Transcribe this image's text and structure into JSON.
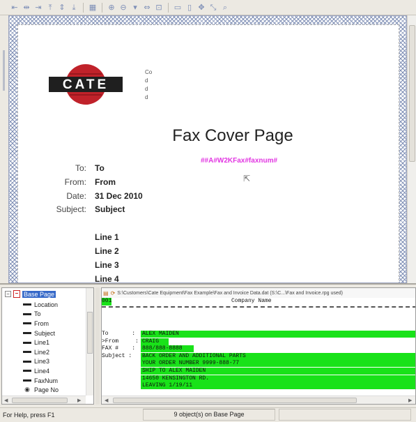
{
  "toolbar": {
    "buttons": [
      {
        "icon": "align-left-icon",
        "glyph": "⇤"
      },
      {
        "icon": "align-center-icon",
        "glyph": "⇹"
      },
      {
        "icon": "align-right-icon",
        "glyph": "⇥"
      },
      {
        "icon": "align-top-icon",
        "glyph": "⤒"
      },
      {
        "icon": "align-middle-icon",
        "glyph": "⇕"
      },
      {
        "icon": "align-bottom-icon",
        "glyph": "⤓"
      },
      {
        "icon": "sep"
      },
      {
        "icon": "grid-icon",
        "glyph": "▦"
      },
      {
        "icon": "sep"
      },
      {
        "icon": "zoom-in-icon",
        "glyph": "⊕"
      },
      {
        "icon": "zoom-out-icon",
        "glyph": "⊖"
      },
      {
        "icon": "zoom-dropdown-icon",
        "glyph": "▾"
      },
      {
        "icon": "fit-width-icon",
        "glyph": "⇔"
      },
      {
        "icon": "fit-page-icon",
        "glyph": "⊡"
      },
      {
        "icon": "sep"
      },
      {
        "icon": "same-width-icon",
        "glyph": "▭"
      },
      {
        "icon": "same-height-icon",
        "glyph": "▯"
      },
      {
        "icon": "move-icon",
        "glyph": "✥"
      },
      {
        "icon": "resize-icon",
        "glyph": "⤡"
      },
      {
        "icon": "find-icon",
        "glyph": "⌕"
      }
    ]
  },
  "design": {
    "logo_text": "CATE",
    "co_text": "Co\nd\nd\nd",
    "title": "Fax Cover Page",
    "fax_field": "##A#W2KFax#faxnum#",
    "cursor_glyph": "⇱",
    "fields": [
      {
        "label": "To:",
        "value": "To"
      },
      {
        "label": "From:",
        "value": "From"
      },
      {
        "label": "Date:",
        "value": "31 Dec 2010"
      },
      {
        "label": "Subject:",
        "value": "Subject"
      }
    ],
    "lines": [
      "Line 1",
      "Line 2",
      "Line 3",
      "Line 4"
    ]
  },
  "tree": {
    "root": "Base Page",
    "expander": "−",
    "items": [
      {
        "label": "Location",
        "icon": "dash"
      },
      {
        "label": "To",
        "icon": "dash"
      },
      {
        "label": "From",
        "icon": "dash"
      },
      {
        "label": "Subject",
        "icon": "dash"
      },
      {
        "label": "Line1",
        "icon": "dash"
      },
      {
        "label": "Line2",
        "icon": "dash"
      },
      {
        "label": "Line3",
        "icon": "dash"
      },
      {
        "label": "Line4",
        "icon": "dash"
      },
      {
        "label": "FaxNum",
        "icon": "dash"
      },
      {
        "label": "Page No",
        "icon": "eye"
      }
    ]
  },
  "data_panel": {
    "path": "S:\\Customers\\Cate Equipment\\Fax Example\\Fax and Invoice Data.dat (S:\\C...\\Fax and Invoice.rpg used)",
    "tag": "001",
    "company": "Company Name",
    "rows": [
      {
        "label": "To       :",
        "value": "ALEX MAIDEN"
      },
      {
        "label": ">From     :",
        "value": "CRAIG"
      },
      {
        "label": "FAX #    :",
        "value": "888/888-8888"
      },
      {
        "label": "Subject :",
        "value": "BACK ORDER AND ADDITIONAL PARTS"
      },
      {
        "label": "",
        "value": "YOUR ORDER NUMBER 9999-888-77"
      },
      {
        "label": "",
        "value": "SHIP TO ALEX MAIDEN"
      },
      {
        "label": "",
        "value": "14650 KENSINGTON RD."
      },
      {
        "label": "",
        "value": "LEAVING 1/19/11"
      }
    ]
  },
  "status": {
    "left": "For Help, press F1",
    "middle": "9 object(s) on Base Page",
    "right": ""
  },
  "colors": {
    "accent_magenta": "#e236e2",
    "highlight_green": "#19e219",
    "tree_selection": "#3568c8",
    "logo_red": "#c0222a"
  }
}
